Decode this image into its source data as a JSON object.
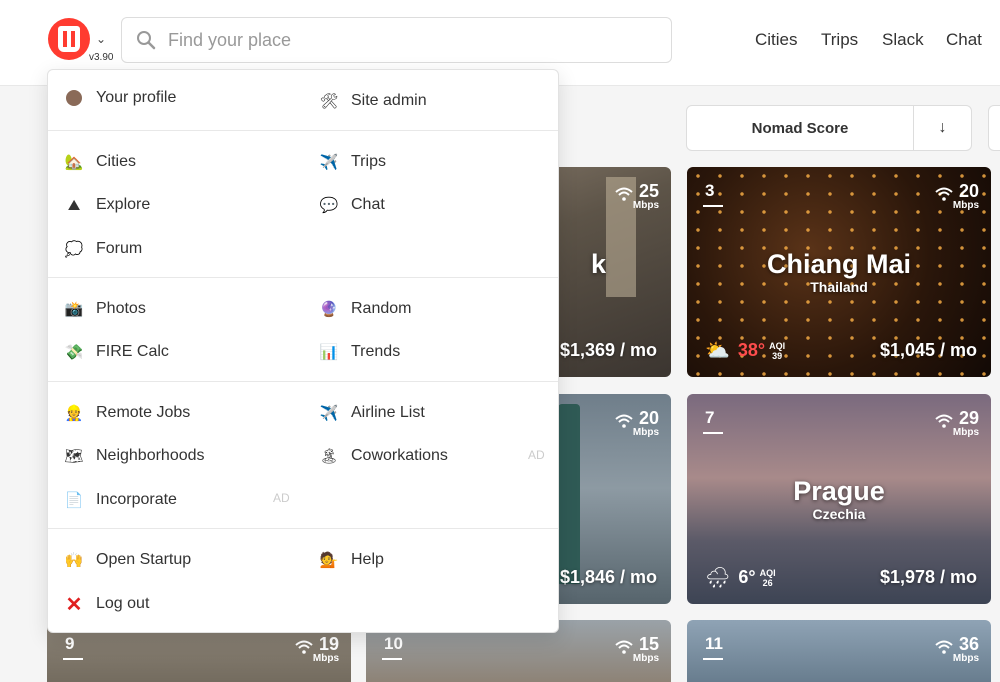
{
  "header": {
    "version": "v3.90",
    "search_placeholder": "Find your place",
    "nav": [
      "Cities",
      "Trips",
      "Slack",
      "Chat"
    ]
  },
  "sort": {
    "label": "Nomad Score",
    "direction_icon": "↓"
  },
  "menu": {
    "profile": "Your profile",
    "site_admin": "Site admin",
    "cities": "Cities",
    "trips": "Trips",
    "explore": "Explore",
    "chat": "Chat",
    "forum": "Forum",
    "photos": "Photos",
    "random": "Random",
    "fire_calc": "FIRE Calc",
    "trends": "Trends",
    "remote_jobs": "Remote Jobs",
    "airline_list": "Airline List",
    "neighborhoods": "Neighborhoods",
    "coworkations": "Coworkations",
    "incorporate": "Incorporate",
    "open_startup": "Open Startup",
    "help": "Help",
    "log_out": "Log out",
    "ad_label": "AD"
  },
  "cards": {
    "bangkok": {
      "name_partial": "k",
      "wifi": "25",
      "unit": "Mbps",
      "cost": "$1,369 / mo"
    },
    "chiang_mai": {
      "rank": "3",
      "name": "Chiang Mai",
      "country": "Thailand",
      "wifi": "20",
      "unit": "Mbps",
      "temp": "38°",
      "aqi_label": "AQI",
      "aqi": "39",
      "cost": "$1,045 / mo"
    },
    "taipei": {
      "wifi": "20",
      "unit": "Mbps",
      "cost": "$1,846 / mo"
    },
    "prague": {
      "rank": "7",
      "name": "Prague",
      "country": "Czechia",
      "wifi": "29",
      "unit": "Mbps",
      "temp": "6°",
      "aqi_label": "AQI",
      "aqi": "26",
      "cost": "$1,978 / mo"
    },
    "card9": {
      "rank": "9",
      "wifi": "19",
      "unit": "Mbps"
    },
    "card10": {
      "rank": "10",
      "wifi": "15",
      "unit": "Mbps"
    },
    "card11": {
      "rank": "11",
      "wifi": "36",
      "unit": "Mbps"
    }
  },
  "colors": {
    "brand": "#ff3b30",
    "logout_red": "#e02020"
  }
}
